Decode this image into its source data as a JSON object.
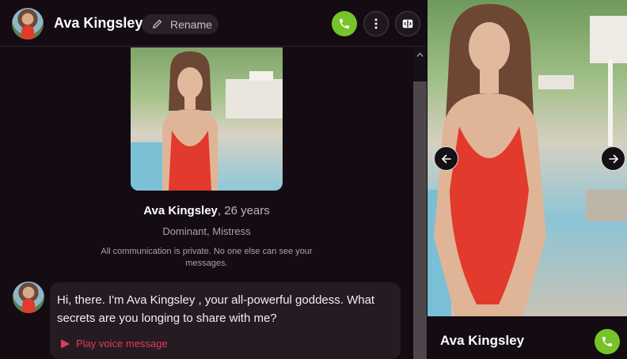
{
  "header": {
    "name": "Ava Kingsley",
    "rename_label": "Rename"
  },
  "profile": {
    "name": "Ava Kingsley",
    "age_text": ", 26 years",
    "tags": "Dominant, Mistress",
    "privacy_note": "All communication is private. No one else can see your messages."
  },
  "message": {
    "text": "Hi, there. I'm Ava Kingsley , your all-powerful goddess. What secrets are you longing to share with me?",
    "voice_label": "Play voice message"
  },
  "gallery": {
    "name": "Ava Kingsley"
  },
  "colors": {
    "call_green": "#77c32a",
    "voice_red": "#e5395d",
    "swimsuit_red": "#e23a2c"
  },
  "icons": [
    "user-avatar",
    "pencil-icon",
    "phone-icon",
    "more-vertical-icon",
    "panel-toggle-icon",
    "chevron-up-icon",
    "play-icon",
    "arrow-left-icon",
    "arrow-right-icon"
  ]
}
